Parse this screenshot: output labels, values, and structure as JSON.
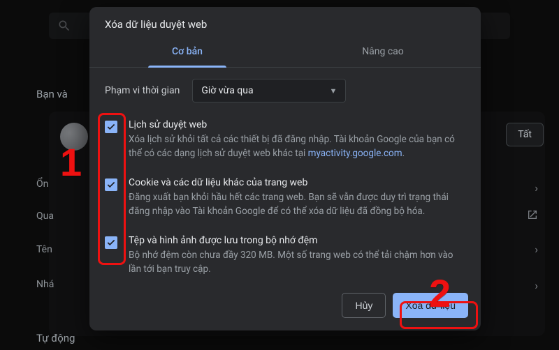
{
  "background": {
    "you_label": "Bạn và",
    "tat_label": "Tất",
    "side": {
      "s1": "Ổn",
      "s2": "Qua",
      "s3": "Tên",
      "s4": "Nhá"
    },
    "auto_label": "Tự động"
  },
  "dialog": {
    "title": "Xóa dữ liệu duyệt web",
    "tabs": {
      "basic": "Cơ bản",
      "advanced": "Nâng cao"
    },
    "time_range": {
      "label": "Phạm vi thời gian",
      "value": "Giờ vừa qua"
    },
    "items": [
      {
        "title": "Lịch sử duyệt web",
        "desc_pre": "Xóa lịch sử khỏi tất cả các thiết bị đã đăng nhập. Tài khoản Google của bạn có thể có các dạng lịch sử duyệt web khác tại ",
        "link": "myactivity.google.com",
        "desc_post": "."
      },
      {
        "title": "Cookie và các dữ liệu khác của trang web",
        "desc": "Đăng xuất bạn khỏi hầu hết các trang web. Bạn sẽ vẫn được duy trì trạng thái đăng nhập vào Tài khoản Google để có thể xóa dữ liệu đã đồng bộ hóa."
      },
      {
        "title": "Tệp và hình ảnh được lưu trong bộ nhớ đệm",
        "desc": "Bộ nhớ đệm còn chưa đầy 320 MB. Một số trang web có thể tải chậm hơn vào lần tới bạn truy cập."
      }
    ],
    "actions": {
      "cancel": "Hủy",
      "confirm": "Xóa dữ liệu"
    }
  },
  "annotations": {
    "n1": "1",
    "n2": "2"
  }
}
